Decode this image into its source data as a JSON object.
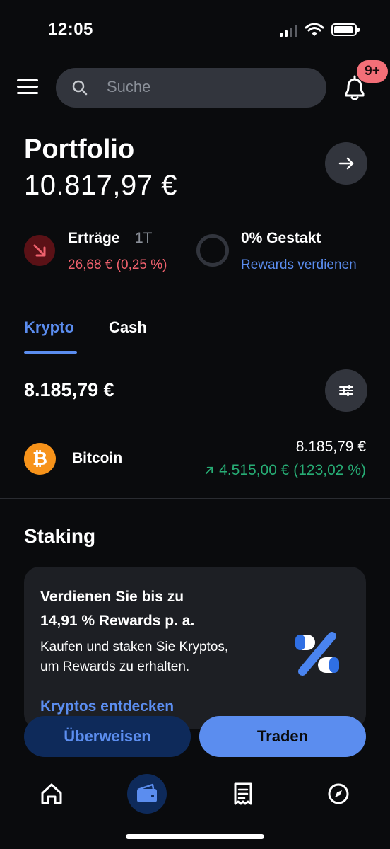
{
  "status_bar": {
    "time": "12:05"
  },
  "header": {
    "search_placeholder": "Suche",
    "notification_badge": "9+"
  },
  "portfolio": {
    "title": "Portfolio",
    "value": "10.817,97 €"
  },
  "earnings": {
    "label": "Erträge",
    "period": "1T",
    "value": "26,68 € (0,25 %)",
    "staked_label": "0% Gestakt",
    "rewards_link": "Rewards verdienen"
  },
  "tabs": [
    {
      "label": "Krypto",
      "active": true
    },
    {
      "label": "Cash",
      "active": false
    }
  ],
  "crypto": {
    "total": "8.185,79 €",
    "assets": [
      {
        "name": "Bitcoin",
        "icon": "bitcoin-icon",
        "symbol_glyph": "₿",
        "value": "8.185,79 €",
        "change": "4.515,00 € (123,02 %)",
        "change_icon": "arrow-up-right-icon"
      }
    ]
  },
  "staking": {
    "title": "Staking",
    "headline_line1": "Verdienen Sie bis zu",
    "headline_line2": "14,91 % Rewards p. a.",
    "body_line1": "Kaufen und staken Sie Kryptos,",
    "body_line2": "um Rewards zu erhalten.",
    "link": "Kryptos entdecken"
  },
  "actions": {
    "transfer": "Überweisen",
    "trade": "Traden"
  },
  "bottom_nav": [
    {
      "icon": "home-icon"
    },
    {
      "icon": "wallet-icon",
      "active": true
    },
    {
      "icon": "receipt-icon"
    },
    {
      "icon": "compass-icon"
    }
  ],
  "colors": {
    "background": "#0a0b0d",
    "accent": "#5b8def",
    "negative": "#f0616d",
    "positive": "#27ad75",
    "surface": "#32353d",
    "card": "#1d1f24"
  }
}
